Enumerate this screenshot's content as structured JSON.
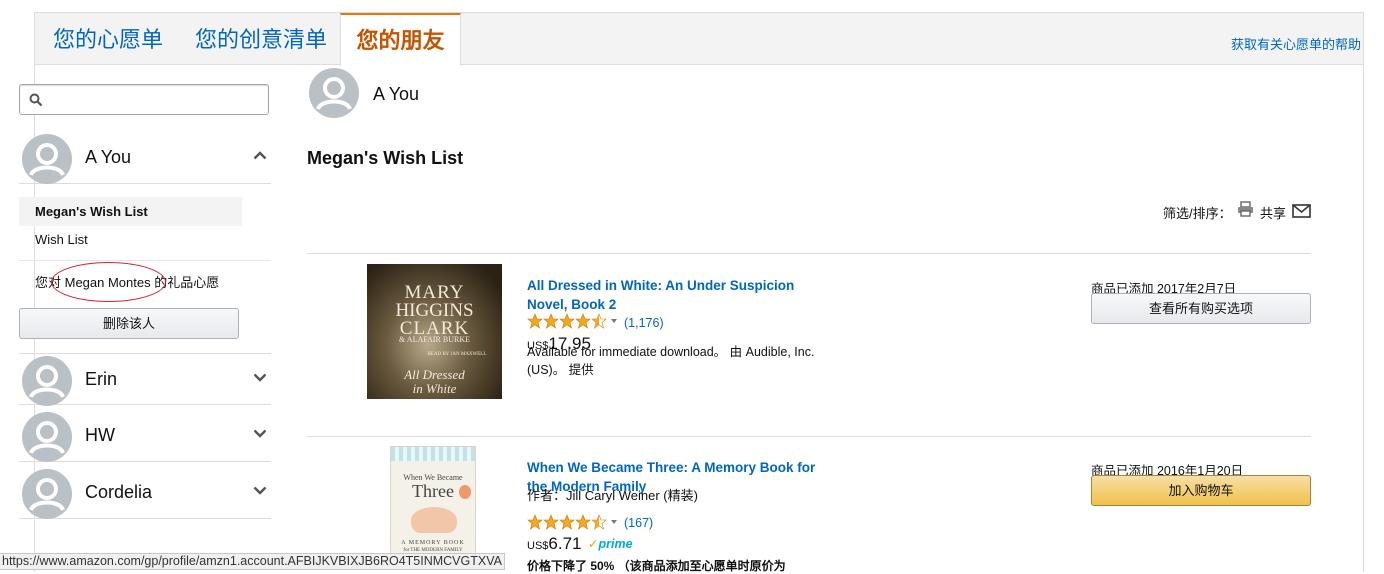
{
  "tabs": [
    {
      "label": "您的心愿单"
    },
    {
      "label": "您的创意清单"
    },
    {
      "label": "您的朋友"
    }
  ],
  "help_link": "获取有关心愿单的帮助",
  "search": {
    "placeholder": ""
  },
  "sidebar": {
    "friends": [
      {
        "name": "A You",
        "expanded": true
      },
      {
        "name": "Erin",
        "expanded": false
      },
      {
        "name": "HW",
        "expanded": false
      },
      {
        "name": "Cordelia",
        "expanded": false
      }
    ],
    "lists": [
      {
        "label": "Megan's Wish List",
        "selected": true
      },
      {
        "label": "Wish List",
        "selected": false
      },
      {
        "label": "您对 Megan Montes 的礼品心愿",
        "selected": false
      }
    ],
    "remove_button": "删除该人"
  },
  "main": {
    "owner_name": "A You",
    "list_title": "Megan's Wish List",
    "filter_label": "筛选/排序：",
    "share_label": "共享",
    "items": [
      {
        "title": "All Dressed in White: An Under Suspicion Novel, Book 2",
        "rating": 4.5,
        "review_count": "(1,176)",
        "currency": "US$",
        "price": "17.95",
        "availability": "Available for immediate download。 由 Audible, Inc. (US)。 提供",
        "added": "商品已添加 2017年2月7日",
        "button": "查看所有购买选项",
        "cover": {
          "author_line1": "MARY",
          "author_line2": "HIGGINS",
          "author_line3": "CLARK",
          "coauthor": "& ALAFAIR BURKE",
          "narrator": "READ BY JAN MAXWELL",
          "title_line1": "All Dressed",
          "title_line2": "in White"
        }
      },
      {
        "title": "When We Became Three: A Memory Book for the Modern Family",
        "author": "作者：Jill Caryl Weiner (精装)",
        "rating": 4.5,
        "review_count": "(167)",
        "currency": "US$",
        "price": "6.71",
        "prime_label": "prime",
        "price_drop": "价格下降了 50% （该商品添加至心愿单时原价为",
        "added": "商品已添加 2016年1月20日",
        "button": "加入购物车",
        "cover": {
          "line1": "When We Became",
          "line2": "Three",
          "line3": "A MEMORY BOOK",
          "line4": "for THE MODERN FAMILY"
        }
      }
    ]
  },
  "status_url": "https://www.amazon.com/gp/profile/amzn1.account.AFBIJKVBIXJB6RO4T5INMCVGTXVA",
  "colors": {
    "link": "#0066c0",
    "active_tab": "#c45500",
    "accent": "#e47911",
    "star": "#f5a623",
    "annotation": "#d9232d"
  }
}
